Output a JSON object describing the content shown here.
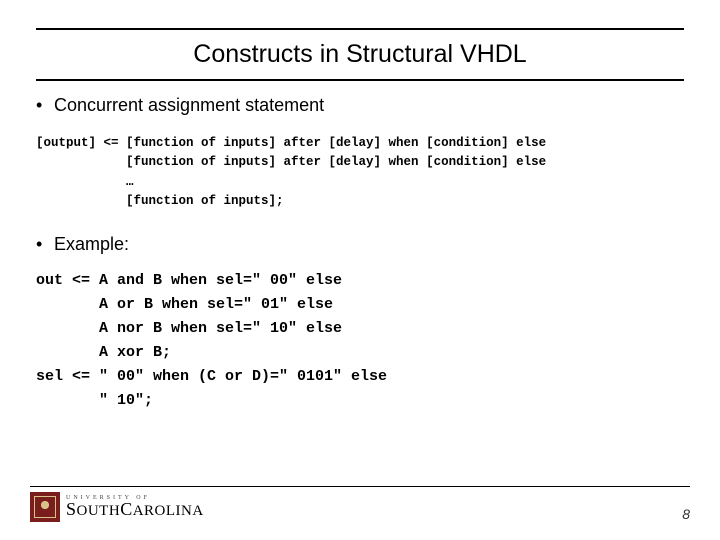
{
  "title": "Constructs in Structural VHDL",
  "bullet1": "Concurrent assignment statement",
  "syntax": {
    "l1": "[output] <= [function of inputs] after [delay] when [condition] else",
    "l2": "            [function of inputs] after [delay] when [condition] else",
    "l3": "            …",
    "l4": "            [function of inputs];"
  },
  "bullet2": "Example:",
  "example": {
    "l1": "out <= A and B when sel=\" 00\" else",
    "l2": "       A or B when sel=\" 01\" else",
    "l3": "       A nor B when sel=\" 10\" else",
    "l4": "       A xor B;",
    "l5": "sel <= \" 00\" when (C or D)=\" 0101\" else",
    "l6": "       \" 10\";"
  },
  "footer": {
    "university_top": "UNIVERSITY OF",
    "university_main_1": "S",
    "university_main_2": "OUTH",
    "university_main_3": "C",
    "university_main_4": "AROLINA",
    "page": "8"
  }
}
